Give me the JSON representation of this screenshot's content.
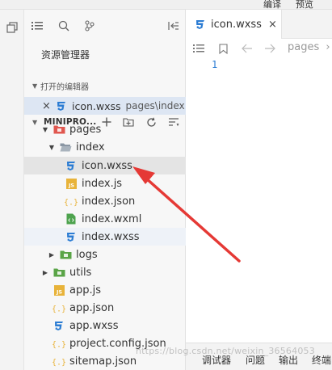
{
  "topbar": {
    "items": [
      "编译",
      "预览"
    ]
  },
  "activity_bar": {
    "icons": [
      "copy-icon"
    ]
  },
  "sidebar": {
    "toolbar_icons": [
      "list-icon",
      "search-icon",
      "branch-icon",
      "collapse-panel-icon"
    ],
    "title": "资源管理器",
    "open_editors": {
      "header": "打开的编辑器",
      "items": [
        {
          "close": "×",
          "name": "icon.wxss",
          "path": "pages\\index"
        }
      ]
    },
    "project": {
      "header": "MINIPRO...",
      "tools": [
        "add-icon",
        "new-folder-icon",
        "refresh-icon",
        "collapse-all-icon"
      ]
    },
    "tree": [
      {
        "name": "pages",
        "type": "folder-red",
        "twisty": "▼",
        "depth": 1
      },
      {
        "name": "index",
        "type": "folder-open",
        "twisty": "▼",
        "depth": 2
      },
      {
        "name": "icon.wxss",
        "type": "wxss",
        "twisty": "",
        "depth": 3,
        "state": "selected"
      },
      {
        "name": "index.js",
        "type": "js",
        "twisty": "",
        "depth": 3
      },
      {
        "name": "index.json",
        "type": "json",
        "twisty": "",
        "depth": 3
      },
      {
        "name": "index.wxml",
        "type": "wxml",
        "twisty": "",
        "depth": 3
      },
      {
        "name": "index.wxss",
        "type": "wxss",
        "twisty": "",
        "depth": 3,
        "state": "highlight"
      },
      {
        "name": "logs",
        "type": "folder-green",
        "twisty": "▶",
        "depth": 2
      },
      {
        "name": "utils",
        "type": "folder-green",
        "twisty": "▶",
        "depth": 1
      },
      {
        "name": "app.js",
        "type": "js",
        "twisty": "",
        "depth": 1
      },
      {
        "name": "app.json",
        "type": "json",
        "twisty": "",
        "depth": 1
      },
      {
        "name": "app.wxss",
        "type": "wxss",
        "twisty": "",
        "depth": 1
      },
      {
        "name": "project.config.json",
        "type": "json",
        "twisty": "",
        "depth": 1
      },
      {
        "name": "sitemap.json",
        "type": "json",
        "twisty": "",
        "depth": 1
      }
    ]
  },
  "editor": {
    "tab": {
      "name": "icon.wxss",
      "close": "×"
    },
    "breadcrumb_icons": [
      "list-icon",
      "bookmark-icon",
      "back-arrow-icon",
      "forward-arrow-icon"
    ],
    "breadcrumb": "pages",
    "breadcrumb_sep": "›",
    "line_numbers": [
      "1"
    ]
  },
  "bottom_panel": {
    "tabs": [
      "调试器",
      "问题",
      "输出",
      "终端"
    ]
  },
  "watermark": "https://blog.csdn.net/weixin_36564053",
  "colors": {
    "wxss": "#2b7cd3",
    "js": "#e8b33a",
    "json": "#e8b33a",
    "wxml": "#4ea34e",
    "folder_red": "#e0574f",
    "folder_green": "#5aa447",
    "arrow": "#e53935"
  }
}
